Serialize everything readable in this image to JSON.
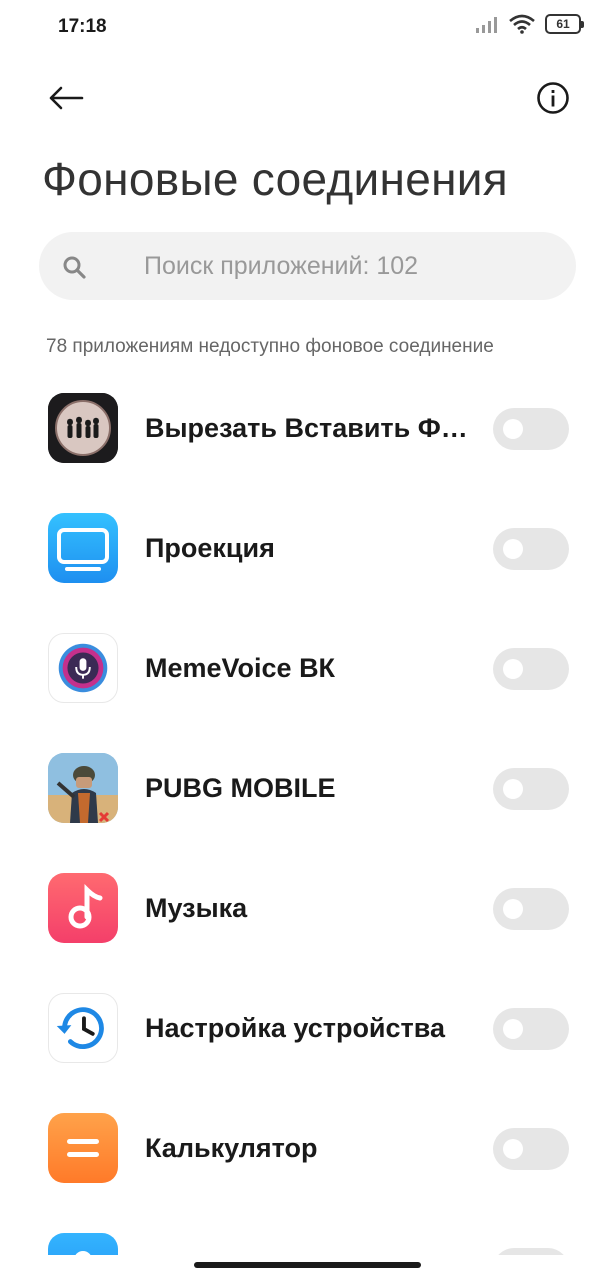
{
  "status_bar": {
    "time": "17:18",
    "battery": "61"
  },
  "header": {
    "title": "Фоновые соединения"
  },
  "search": {
    "placeholder": "Поиск приложений: 102"
  },
  "subtitle": "78 приложениям недоступно фоновое соединение",
  "apps": [
    {
      "name": "Вырезать Вставить Фото",
      "icon": "cut-paste-photo-icon",
      "enabled": false
    },
    {
      "name": "Проекция",
      "icon": "projection-icon",
      "enabled": false
    },
    {
      "name": "MemeVoice ВК",
      "icon": "memevoice-mic-icon",
      "enabled": false
    },
    {
      "name": "PUBG MOBILE",
      "icon": "pubg-icon",
      "enabled": false
    },
    {
      "name": "Музыка",
      "icon": "music-icon",
      "enabled": false
    },
    {
      "name": "Настройка устройства",
      "icon": "device-setup-icon",
      "enabled": false
    },
    {
      "name": "Калькулятор",
      "icon": "calculator-icon",
      "enabled": false
    },
    {
      "name": "",
      "icon": "contacts-icon",
      "enabled": false
    }
  ],
  "colors": {
    "toggle_off": "#e6e6e6",
    "accent_blue": "#2196f3"
  }
}
